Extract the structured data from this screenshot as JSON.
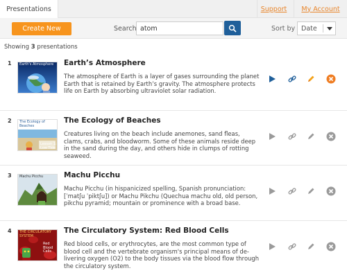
{
  "tabs": {
    "active": "Presentations"
  },
  "links": {
    "support": "Support",
    "account": "My Account"
  },
  "toolbar": {
    "create_label": "Create New",
    "search_label": "Search",
    "search_value": "atom",
    "sort_label": "Sort by",
    "sort_value": "Date"
  },
  "showing": {
    "prefix": "Showing",
    "count": "3",
    "suffix": "presentations"
  },
  "presentations": [
    {
      "number": "1",
      "title": "Earth’s Atmosphere",
      "description": "The atmosphere of Earth is a layer of gases surrounding the planet Earth that is retained by Earth’s gravity. The atmosphere protects life on Earth by absorbing ultraviolet solar radiation.",
      "thumb_caption": "Earth's Atmosphere",
      "active": true
    },
    {
      "number": "2",
      "title": "The Ecology of Beaches",
      "description": "Creatures living on the beach include anemones, sand fleas, clams, crabs, and bloodworm. Some of these animals reside deep in the sand during the day, and others hide in clumps of rotting seaweed.",
      "thumb_caption": "The Ecology of Beaches",
      "thumb_subcaption": "Lesson 1: Low Tide",
      "active": false
    },
    {
      "number": "3",
      "title": "Machu Picchu",
      "description": "Machu Picchu (in hispanicized spelling, Spanish pronunciation: [ˈmatʃu ˈpiktʃu]) or Machu Pikchu (Quechua machu old, old person, pikchu pyramid; mountain or prominence with a broad base.",
      "thumb_caption": "Machu Picchu",
      "active": false
    },
    {
      "number": "4",
      "title": "The Circulatory System: Red Blood Cells",
      "description": "Red blood cells, or erythrocytes, are the most common type of blood cell and the vertebrate organism's principal means of de-livering oxygen (O2) to the body tissues via the blood flow through the circulatory system.",
      "thumb_caption": "THE CIRCULATORY SYSTEM",
      "thumb_subcaption": "Red Blood Cells",
      "active": false
    }
  ],
  "colors": {
    "accent": "#f7941d",
    "search_button": "#1f5f9a",
    "active_play": "#1f5f9a",
    "active_link": "#1f5f9a",
    "active_edit": "#f4a21a",
    "active_delete": "#ef7d22",
    "inactive_icon": "#9a9a9a"
  }
}
